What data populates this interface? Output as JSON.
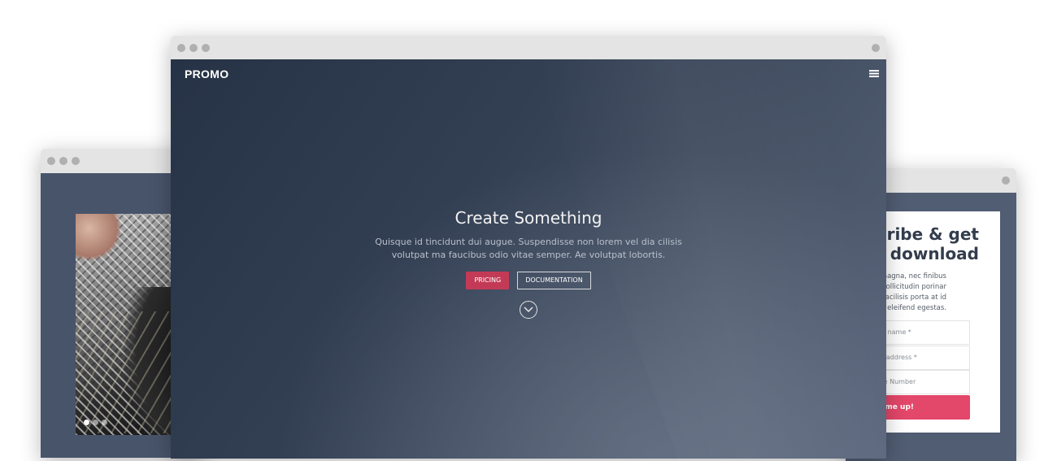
{
  "left_window": {
    "slider_dots": 3,
    "active_dot": 0
  },
  "center_window": {
    "brand": "PROMO",
    "hero": {
      "title": "Create Something",
      "text": "Quisque id tincidunt dui augue. Suspendisse non lorem vel dia cilisis volutpat ma faucibus odio vitae semper. Ae volutpat lobortis.",
      "primary_button": "PRICING",
      "secondary_button": "DOCUMENTATION"
    },
    "icons": {
      "menu": "hamburger-menu-icon",
      "scroll": "chevron-down-circle-icon"
    }
  },
  "right_window": {
    "heading": "scribe & get\nr download",
    "body": "nissim dictum magna, nec finibus\nallis in. Cras sollicitudin porinar\nn. Nibh at nisi facilisis porta at id\nus at justo eleifend egestas.",
    "fields": {
      "first_name": "First name *",
      "email": "Email address *",
      "phone": "Phone Number"
    },
    "submit": "nished, sign me up!"
  },
  "colors": {
    "accent": "#c33a56",
    "submit": "#e3476a",
    "hero_bg": "#333f53"
  }
}
